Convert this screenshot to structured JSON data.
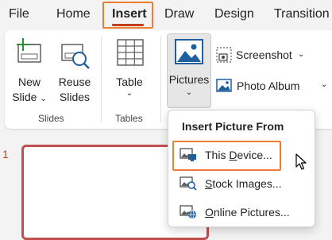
{
  "tabs": {
    "file": "File",
    "home": "Home",
    "insert": "Insert",
    "draw": "Draw",
    "design": "Design",
    "transitions": "Transition"
  },
  "ribbon": {
    "new_slide_line1": "New",
    "new_slide_line2": "Slide",
    "reuse_slides_line1": "Reuse",
    "reuse_slides_line2": "Slides",
    "slides_group": "Slides",
    "table": "Table",
    "tables_group": "Tables",
    "pictures": "Pictures",
    "screenshot": "Screenshot",
    "photo_album": "Photo Album"
  },
  "slide_panel": {
    "slide_number": "1"
  },
  "menu": {
    "title": "Insert Picture From",
    "items": [
      {
        "pre": "This ",
        "key": "D",
        "post": "evice...",
        "icon": "this-device-icon"
      },
      {
        "pre": "",
        "key": "S",
        "post": "tock Images...",
        "icon": "stock-images-icon"
      },
      {
        "pre": "",
        "key": "O",
        "post": "nline Pictures...",
        "icon": "online-pictures-icon"
      }
    ]
  },
  "colors": {
    "accent": "#c43e1c",
    "highlight": "#ed7d31",
    "picture_blue": "#1f5f9e"
  }
}
